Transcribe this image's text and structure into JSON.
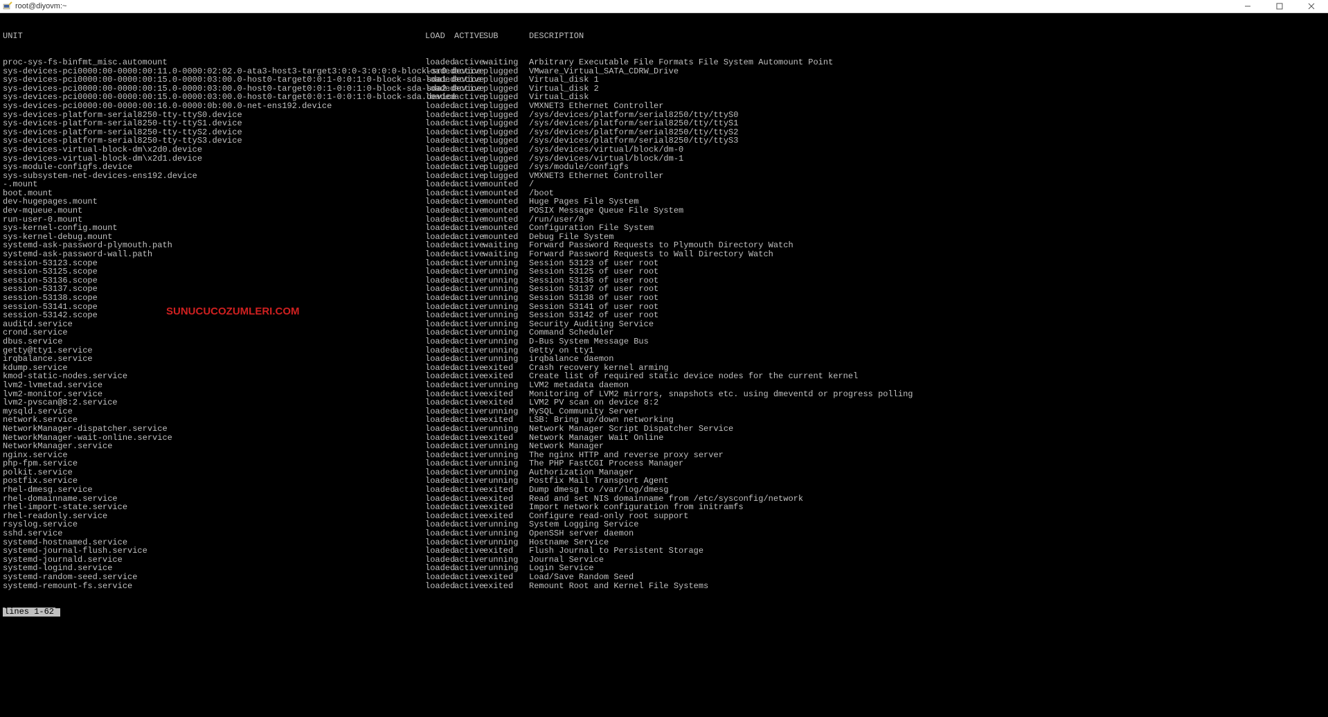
{
  "window": {
    "title": "root@diyovm:~"
  },
  "watermark": "SUNUCUCOZUMLERI.COM",
  "statusline": "lines 1-62",
  "headers": {
    "unit": "UNIT",
    "load": "LOAD",
    "active": "ACTIVE",
    "sub": "SUB",
    "description": "DESCRIPTION"
  },
  "units": [
    {
      "u": "proc-sys-fs-binfmt_misc.automount",
      "l": "loaded",
      "a": "active",
      "s": "waiting",
      "d": "Arbitrary Executable File Formats File System Automount Point"
    },
    {
      "u": "sys-devices-pci0000:00-0000:00:11.0-0000:02:02.0-ata3-host3-target3:0:0-3:0:0:0-block-sr0.device",
      "l": "loaded",
      "a": "active",
      "s": "plugged",
      "d": "VMware_Virtual_SATA_CDRW_Drive"
    },
    {
      "u": "sys-devices-pci0000:00-0000:00:15.0-0000:03:00.0-host0-target0:0:1-0:0:1:0-block-sda-sda1.device",
      "l": "loaded",
      "a": "active",
      "s": "plugged",
      "d": "Virtual_disk 1"
    },
    {
      "u": "sys-devices-pci0000:00-0000:00:15.0-0000:03:00.0-host0-target0:0:1-0:0:1:0-block-sda-sda2.device",
      "l": "loaded",
      "a": "active",
      "s": "plugged",
      "d": "Virtual_disk 2"
    },
    {
      "u": "sys-devices-pci0000:00-0000:00:15.0-0000:03:00.0-host0-target0:0:1-0:0:1:0-block-sda.device",
      "l": "loaded",
      "a": "active",
      "s": "plugged",
      "d": "Virtual_disk"
    },
    {
      "u": "sys-devices-pci0000:00-0000:00:16.0-0000:0b:00.0-net-ens192.device",
      "l": "loaded",
      "a": "active",
      "s": "plugged",
      "d": "VMXNET3 Ethernet Controller"
    },
    {
      "u": "sys-devices-platform-serial8250-tty-ttyS0.device",
      "l": "loaded",
      "a": "active",
      "s": "plugged",
      "d": "/sys/devices/platform/serial8250/tty/ttyS0"
    },
    {
      "u": "sys-devices-platform-serial8250-tty-ttyS1.device",
      "l": "loaded",
      "a": "active",
      "s": "plugged",
      "d": "/sys/devices/platform/serial8250/tty/ttyS1"
    },
    {
      "u": "sys-devices-platform-serial8250-tty-ttyS2.device",
      "l": "loaded",
      "a": "active",
      "s": "plugged",
      "d": "/sys/devices/platform/serial8250/tty/ttyS2"
    },
    {
      "u": "sys-devices-platform-serial8250-tty-ttyS3.device",
      "l": "loaded",
      "a": "active",
      "s": "plugged",
      "d": "/sys/devices/platform/serial8250/tty/ttyS3"
    },
    {
      "u": "sys-devices-virtual-block-dm\\x2d0.device",
      "l": "loaded",
      "a": "active",
      "s": "plugged",
      "d": "/sys/devices/virtual/block/dm-0"
    },
    {
      "u": "sys-devices-virtual-block-dm\\x2d1.device",
      "l": "loaded",
      "a": "active",
      "s": "plugged",
      "d": "/sys/devices/virtual/block/dm-1"
    },
    {
      "u": "sys-module-configfs.device",
      "l": "loaded",
      "a": "active",
      "s": "plugged",
      "d": "/sys/module/configfs"
    },
    {
      "u": "sys-subsystem-net-devices-ens192.device",
      "l": "loaded",
      "a": "active",
      "s": "plugged",
      "d": "VMXNET3 Ethernet Controller"
    },
    {
      "u": "-.mount",
      "l": "loaded",
      "a": "active",
      "s": "mounted",
      "d": "/"
    },
    {
      "u": "boot.mount",
      "l": "loaded",
      "a": "active",
      "s": "mounted",
      "d": "/boot"
    },
    {
      "u": "dev-hugepages.mount",
      "l": "loaded",
      "a": "active",
      "s": "mounted",
      "d": "Huge Pages File System"
    },
    {
      "u": "dev-mqueue.mount",
      "l": "loaded",
      "a": "active",
      "s": "mounted",
      "d": "POSIX Message Queue File System"
    },
    {
      "u": "run-user-0.mount",
      "l": "loaded",
      "a": "active",
      "s": "mounted",
      "d": "/run/user/0"
    },
    {
      "u": "sys-kernel-config.mount",
      "l": "loaded",
      "a": "active",
      "s": "mounted",
      "d": "Configuration File System"
    },
    {
      "u": "sys-kernel-debug.mount",
      "l": "loaded",
      "a": "active",
      "s": "mounted",
      "d": "Debug File System"
    },
    {
      "u": "systemd-ask-password-plymouth.path",
      "l": "loaded",
      "a": "active",
      "s": "waiting",
      "d": "Forward Password Requests to Plymouth Directory Watch"
    },
    {
      "u": "systemd-ask-password-wall.path",
      "l": "loaded",
      "a": "active",
      "s": "waiting",
      "d": "Forward Password Requests to Wall Directory Watch"
    },
    {
      "u": "session-53123.scope",
      "l": "loaded",
      "a": "active",
      "s": "running",
      "d": "Session 53123 of user root"
    },
    {
      "u": "session-53125.scope",
      "l": "loaded",
      "a": "active",
      "s": "running",
      "d": "Session 53125 of user root"
    },
    {
      "u": "session-53136.scope",
      "l": "loaded",
      "a": "active",
      "s": "running",
      "d": "Session 53136 of user root"
    },
    {
      "u": "session-53137.scope",
      "l": "loaded",
      "a": "active",
      "s": "running",
      "d": "Session 53137 of user root"
    },
    {
      "u": "session-53138.scope",
      "l": "loaded",
      "a": "active",
      "s": "running",
      "d": "Session 53138 of user root"
    },
    {
      "u": "session-53141.scope",
      "l": "loaded",
      "a": "active",
      "s": "running",
      "d": "Session 53141 of user root"
    },
    {
      "u": "session-53142.scope",
      "l": "loaded",
      "a": "active",
      "s": "running",
      "d": "Session 53142 of user root"
    },
    {
      "u": "auditd.service",
      "l": "loaded",
      "a": "active",
      "s": "running",
      "d": "Security Auditing Service"
    },
    {
      "u": "crond.service",
      "l": "loaded",
      "a": "active",
      "s": "running",
      "d": "Command Scheduler"
    },
    {
      "u": "dbus.service",
      "l": "loaded",
      "a": "active",
      "s": "running",
      "d": "D-Bus System Message Bus"
    },
    {
      "u": "getty@tty1.service",
      "l": "loaded",
      "a": "active",
      "s": "running",
      "d": "Getty on tty1"
    },
    {
      "u": "irqbalance.service",
      "l": "loaded",
      "a": "active",
      "s": "running",
      "d": "irqbalance daemon"
    },
    {
      "u": "kdump.service",
      "l": "loaded",
      "a": "active",
      "s": "exited",
      "d": "Crash recovery kernel arming"
    },
    {
      "u": "kmod-static-nodes.service",
      "l": "loaded",
      "a": "active",
      "s": "exited",
      "d": "Create list of required static device nodes for the current kernel"
    },
    {
      "u": "lvm2-lvmetad.service",
      "l": "loaded",
      "a": "active",
      "s": "running",
      "d": "LVM2 metadata daemon"
    },
    {
      "u": "lvm2-monitor.service",
      "l": "loaded",
      "a": "active",
      "s": "exited",
      "d": "Monitoring of LVM2 mirrors, snapshots etc. using dmeventd or progress polling"
    },
    {
      "u": "lvm2-pvscan@8:2.service",
      "l": "loaded",
      "a": "active",
      "s": "exited",
      "d": "LVM2 PV scan on device 8:2"
    },
    {
      "u": "mysqld.service",
      "l": "loaded",
      "a": "active",
      "s": "running",
      "d": "MySQL Community Server"
    },
    {
      "u": "network.service",
      "l": "loaded",
      "a": "active",
      "s": "exited",
      "d": "LSB: Bring up/down networking"
    },
    {
      "u": "NetworkManager-dispatcher.service",
      "l": "loaded",
      "a": "active",
      "s": "running",
      "d": "Network Manager Script Dispatcher Service"
    },
    {
      "u": "NetworkManager-wait-online.service",
      "l": "loaded",
      "a": "active",
      "s": "exited",
      "d": "Network Manager Wait Online"
    },
    {
      "u": "NetworkManager.service",
      "l": "loaded",
      "a": "active",
      "s": "running",
      "d": "Network Manager"
    },
    {
      "u": "nginx.service",
      "l": "loaded",
      "a": "active",
      "s": "running",
      "d": "The nginx HTTP and reverse proxy server"
    },
    {
      "u": "php-fpm.service",
      "l": "loaded",
      "a": "active",
      "s": "running",
      "d": "The PHP FastCGI Process Manager"
    },
    {
      "u": "polkit.service",
      "l": "loaded",
      "a": "active",
      "s": "running",
      "d": "Authorization Manager"
    },
    {
      "u": "postfix.service",
      "l": "loaded",
      "a": "active",
      "s": "running",
      "d": "Postfix Mail Transport Agent"
    },
    {
      "u": "rhel-dmesg.service",
      "l": "loaded",
      "a": "active",
      "s": "exited",
      "d": "Dump dmesg to /var/log/dmesg"
    },
    {
      "u": "rhel-domainname.service",
      "l": "loaded",
      "a": "active",
      "s": "exited",
      "d": "Read and set NIS domainname from /etc/sysconfig/network"
    },
    {
      "u": "rhel-import-state.service",
      "l": "loaded",
      "a": "active",
      "s": "exited",
      "d": "Import network configuration from initramfs"
    },
    {
      "u": "rhel-readonly.service",
      "l": "loaded",
      "a": "active",
      "s": "exited",
      "d": "Configure read-only root support"
    },
    {
      "u": "rsyslog.service",
      "l": "loaded",
      "a": "active",
      "s": "running",
      "d": "System Logging Service"
    },
    {
      "u": "sshd.service",
      "l": "loaded",
      "a": "active",
      "s": "running",
      "d": "OpenSSH server daemon"
    },
    {
      "u": "systemd-hostnamed.service",
      "l": "loaded",
      "a": "active",
      "s": "running",
      "d": "Hostname Service"
    },
    {
      "u": "systemd-journal-flush.service",
      "l": "loaded",
      "a": "active",
      "s": "exited",
      "d": "Flush Journal to Persistent Storage"
    },
    {
      "u": "systemd-journald.service",
      "l": "loaded",
      "a": "active",
      "s": "running",
      "d": "Journal Service"
    },
    {
      "u": "systemd-logind.service",
      "l": "loaded",
      "a": "active",
      "s": "running",
      "d": "Login Service"
    },
    {
      "u": "systemd-random-seed.service",
      "l": "loaded",
      "a": "active",
      "s": "exited",
      "d": "Load/Save Random Seed"
    },
    {
      "u": "systemd-remount-fs.service",
      "l": "loaded",
      "a": "active",
      "s": "exited",
      "d": "Remount Root and Kernel File Systems"
    }
  ]
}
